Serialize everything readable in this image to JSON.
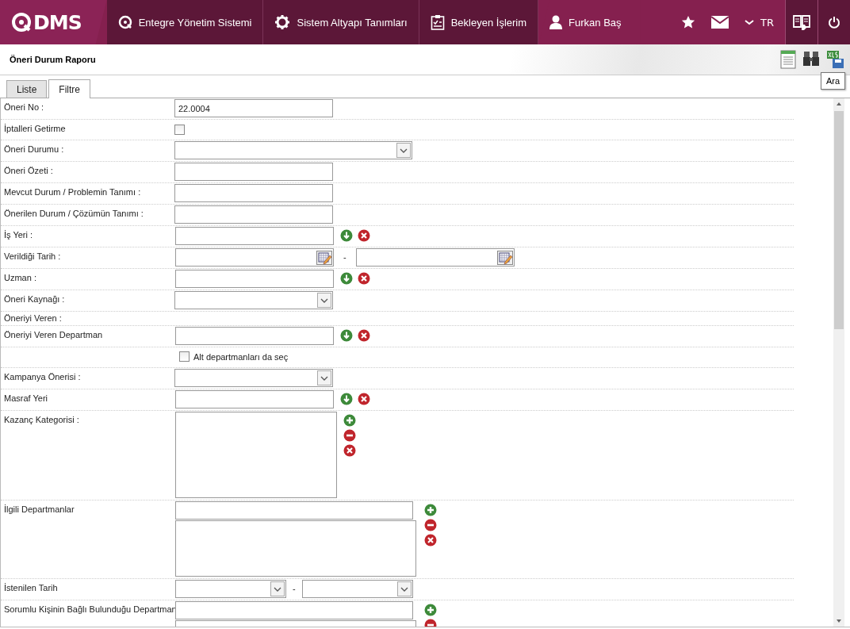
{
  "header": {
    "logo_text": "DMS",
    "nav": [
      {
        "kind": "system",
        "label": "Entegre Yönetim Sistemi"
      },
      {
        "kind": "settings",
        "label": "Sistem Altyapı Tanımları"
      },
      {
        "kind": "tasks",
        "label": "Bekleyen İşlerim"
      },
      {
        "kind": "user",
        "label": "Furkan Baş"
      }
    ],
    "language": "TR"
  },
  "page": {
    "title": "Öneri Durum Raporu",
    "tooltip": "Ara"
  },
  "tabs": [
    {
      "label": "Liste",
      "selected": false
    },
    {
      "label": "Filtre",
      "selected": true
    }
  ],
  "form": [
    {
      "kind": "text",
      "label": "Öneri No :",
      "value": "22.0004"
    },
    {
      "kind": "checkbox",
      "label": "İptalleri Getirme",
      "checked": false
    },
    {
      "kind": "select",
      "label": "Öneri Durumu :",
      "wide": true
    },
    {
      "kind": "text",
      "label": "Öneri Özeti :"
    },
    {
      "kind": "text",
      "label": "Mevcut Durum / Problemin Tanımı :"
    },
    {
      "kind": "text",
      "label": "Önerilen Durum / Çözümün Tanımı :"
    },
    {
      "kind": "lookup",
      "label": "İş Yeri :"
    },
    {
      "kind": "daterange",
      "label": "Verildiği Tarih :",
      "separator": "-"
    },
    {
      "kind": "lookup",
      "label": "Uzman :"
    },
    {
      "kind": "select",
      "label": "Öneri Kaynağı :",
      "wide": false
    },
    {
      "kind": "heading",
      "label": "Öneriyi Veren :"
    },
    {
      "kind": "lookup",
      "label": "Öneriyi Veren Departman"
    },
    {
      "kind": "subcheckbox",
      "label": "Alt departmanları da seç",
      "checked": false
    },
    {
      "kind": "select",
      "label": "Kampanya Önerisi :",
      "wide": false
    },
    {
      "kind": "lookup",
      "label": "Masraf Yeri"
    },
    {
      "kind": "listbox",
      "label": "Kazanç Kategorisi :"
    },
    {
      "kind": "multilookup",
      "label": "İlgili Departmanlar"
    },
    {
      "kind": "selectrange",
      "label": "İstenilen Tarih",
      "separator": "-"
    },
    {
      "kind": "multilookup",
      "label": "Sorumlu Kişinin Bağlı Bulunduğu Departman"
    }
  ]
}
